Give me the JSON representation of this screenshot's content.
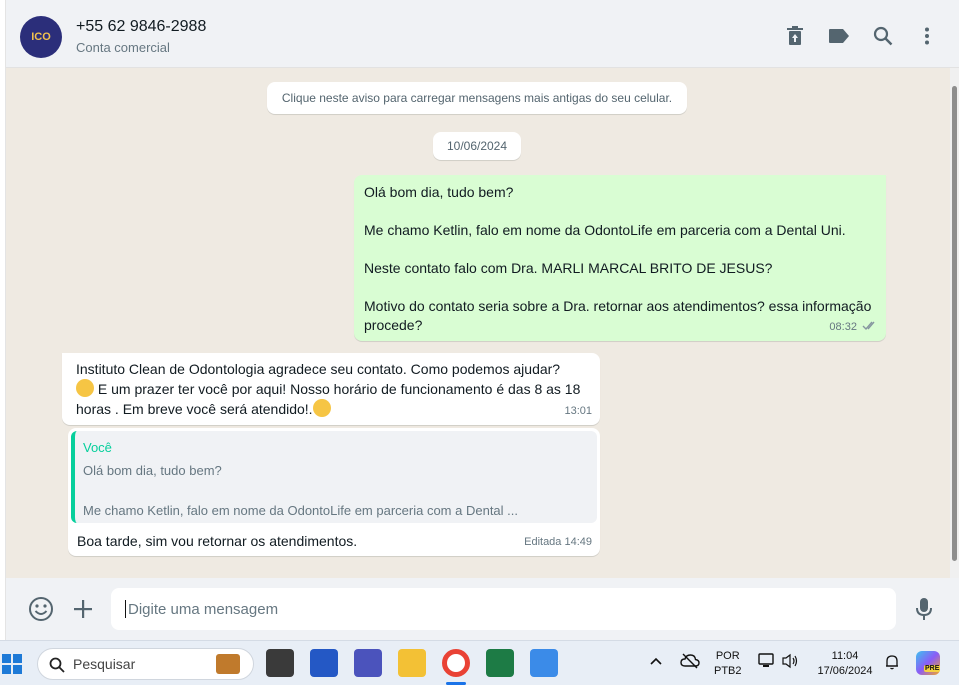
{
  "header": {
    "avatar_text": "ICO",
    "contact_name": "+55 62 9846-2988",
    "subtitle": "Conta comercial",
    "icons": [
      "trash-icon",
      "label-icon",
      "search-icon",
      "menu-icon"
    ]
  },
  "chat": {
    "load_older_notice": "Clique neste aviso para carregar mensagens mais antigas do seu celular.",
    "date_chip": "10/06/2024",
    "outgoing": {
      "lines": [
        "Olá bom dia, tudo bem?",
        "Me chamo Ketlin, falo em nome da OdontoLife em parceria com a Dental Uni.",
        "Neste contato falo com Dra. MARLI MARCAL BRITO DE JESUS?",
        "Motivo do contato seria sobre a Dra. retornar aos atendimentos? essa informação procede?"
      ],
      "time": "08:32"
    },
    "incoming1": {
      "text_a": "Instituto  Clean  de Odontologia agradece seu contato. Como podemos ajudar?",
      "text_b": " E um prazer ter você por aqui! Nosso horário de funcionamento é das 8 as 18 horas . Em breve você será atendido!.",
      "time": "13:01"
    },
    "incoming2": {
      "quote_author": "Você",
      "quote_line1": "Olá bom dia, tudo bem?",
      "quote_line2": "Me chamo Ketlin, falo em nome da OdontoLife em parceria com a Dental ...",
      "reply": "Boa tarde, sim vou retornar os atendimentos.",
      "time": "Editada 14:49"
    }
  },
  "composer": {
    "placeholder": "Digite uma mensagem"
  },
  "taskbar": {
    "search_label": "Pesquisar",
    "lang_top": "POR",
    "lang_bottom": "PTB2",
    "clock_time": "11:04",
    "clock_date": "17/06/2024",
    "copilot_badge": "PRE"
  },
  "colors": {
    "outgoing_bubble": "#d9fdd3",
    "quote_accent": "#06cf9c",
    "chat_bg": "#efeae2"
  }
}
